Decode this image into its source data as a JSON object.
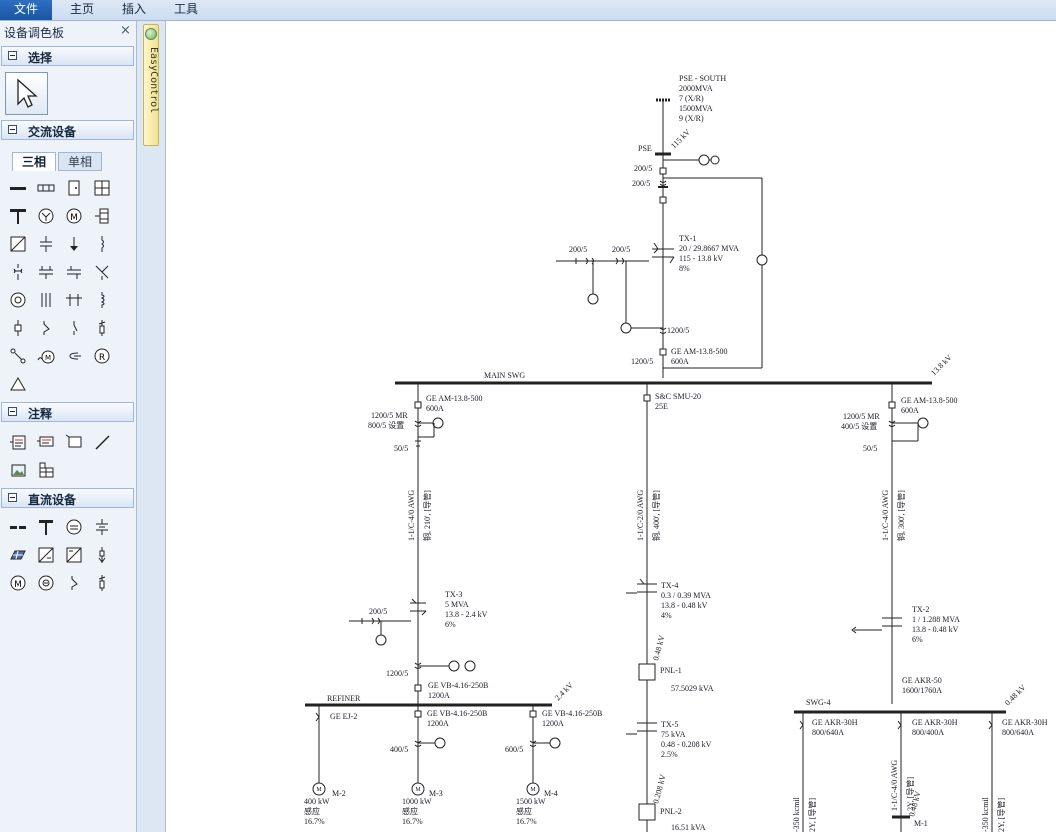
{
  "menu": {
    "items": [
      "文件",
      "主页",
      "插入",
      "工具"
    ]
  },
  "palette": {
    "title": "设备调色板",
    "close": "×",
    "sections": {
      "select": "选择",
      "ac": "交流设备",
      "notes": "注释",
      "dc": "直流设备"
    },
    "tabs": {
      "three_phase": "三相",
      "single_phase": "单相"
    }
  },
  "strip": {
    "label": "EasyControl"
  },
  "diagram": {
    "source": {
      "name": "PSE - SOUTH",
      "l1": "2000MVA",
      "l2": "7 (X/R)",
      "l3": "1500MVA",
      "l4": "9 (X/R)"
    },
    "pse": "PSE",
    "kv115": "115 kV",
    "ct1": "200/5",
    "ct2": "200/5",
    "tx1": {
      "name": "TX-1",
      "mva": "20 / 29.8667 MVA",
      "kv": "115 - 13.8 kV",
      "z": "8%"
    },
    "ct3": "200/5",
    "ct4": "200/5",
    "ct5": "1200/5",
    "main_brk": {
      "name": "GE AM-13.8-500",
      "amp": "600A"
    },
    "ct6": "1200/5",
    "main_swg": "MAIN SWG",
    "kv138": "13.8 kV",
    "left_feeder": {
      "brk": "GE AM-13.8-500",
      "amp": "600A",
      "ct": "1200/5 MR",
      "ct_set": "800/5 设置",
      "ct2": "50/5",
      "cable_a": "1-1/C-4/0 AWG",
      "cable_b": "铜, 210', [导管]",
      "tx": {
        "name": "TX-3",
        "mva": "5 MVA",
        "kv": "13.8 - 2.4 kV",
        "z": "6%"
      },
      "ct3": "200/5",
      "ct4": "1200/5",
      "brk2": "GE VB-4.16-250B",
      "amp2": "1200A"
    },
    "mid_feeder": {
      "brk": "S&C SMU-20",
      "amp": "25E",
      "cable_a": "1-1/C-2/0 AWG",
      "cable_b": "铜, 400', [导管]",
      "tx4": {
        "name": "TX-4",
        "mva": "0.3 / 0.39 MVA",
        "kv": "13.8 - 0.48 kV",
        "z": "4%"
      },
      "kv048": "0.48 kV",
      "pnl1": {
        "name": "PNL-1",
        "load": "57.5029 kVA"
      },
      "tx5": {
        "name": "TX-5",
        "mva": "75 kVA",
        "kv": "0.48 - 0.208 kV",
        "z": "2.5%"
      },
      "kv0208": "0.208 kV",
      "pnl2": {
        "name": "PNL-2",
        "load": "16.51 kVA"
      }
    },
    "right_feeder": {
      "brk": "GE AM-13.8-500",
      "amp": "600A",
      "ct": "1200/5 MR",
      "ct_set": "400/5 设置",
      "ct2": "50/5",
      "cable_a": "1-1/C-4/0 AWG",
      "cable_b": "铜, 300', [导管]",
      "tx": {
        "name": "TX-2",
        "mva": "1 / 1.288 MVA",
        "kv": "13.8 - 0.48 kV",
        "z": "6%"
      },
      "brk2": "GE AKR-50",
      "amp2": "1600/1760A"
    },
    "refiner": {
      "name": "REFINER",
      "kv": "2.4 kV"
    },
    "motors": [
      {
        "brk": "GE EJ-2",
        "name": "M-2",
        "kw": "400 kW",
        "type": "感应",
        "pct": "16.7%"
      },
      {
        "brk": "GE VB-4.16-250B",
        "amp": "1200A",
        "ct": "400/5",
        "name": "M-3",
        "kw": "1000 kW",
        "type": "感应",
        "pct": "16.7%"
      },
      {
        "brk": "GE VB-4.16-250B",
        "amp": "1200A",
        "ct": "600/5",
        "name": "M-4",
        "kw": "1500 kW",
        "type": "感应",
        "pct": "16.7%"
      }
    ],
    "swg4": {
      "name": "SWG-4",
      "kv": "0.48 kV"
    },
    "lv": [
      {
        "brk": "GE AKR-30H",
        "amp": "800/640A",
        "cable": "-350 kcmil",
        "cable2": "2Y, [导管]"
      },
      {
        "brk": "GE AKR-30H",
        "amp": "800/400A",
        "cable": "1-1/C-4/0 AWG",
        "cable2": "2Y, [导管]",
        "kv": "0.48 kV",
        "name": "M-1"
      },
      {
        "brk": "GE AKR-30H",
        "amp": "800/640A",
        "cable": "-350 kcmil",
        "cable2": "2Y, [导管]"
      }
    ]
  }
}
